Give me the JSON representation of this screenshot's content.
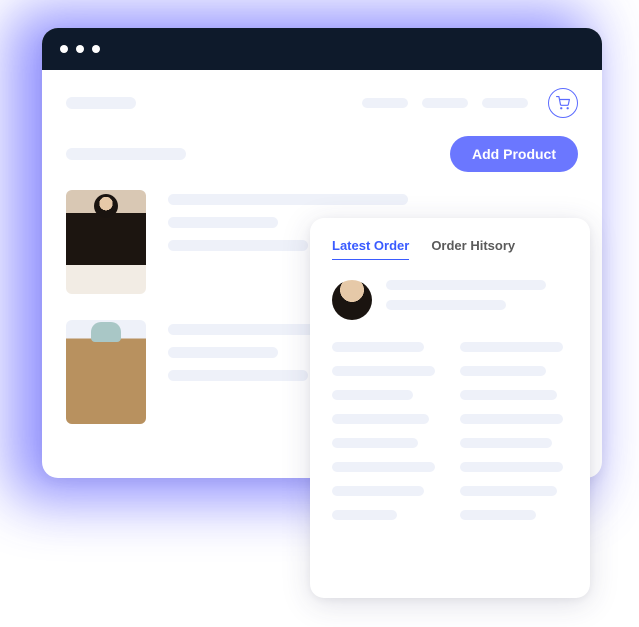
{
  "header": {
    "add_product_label": "Add Product"
  },
  "order_panel": {
    "tabs": {
      "latest": "Latest Order",
      "history": "Order Hitsory"
    }
  },
  "colors": {
    "accent": "#3a5bff",
    "button": "#6b77ff",
    "glow": "#3a3aff",
    "titlebar": "#0e1a2b",
    "skeleton": "#eef1f9"
  }
}
